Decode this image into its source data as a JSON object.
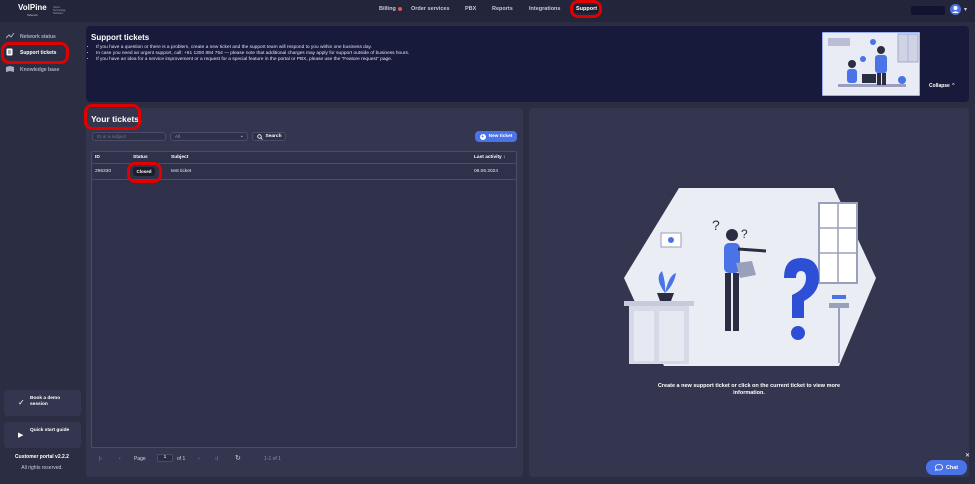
{
  "brand": {
    "name": "VolPine",
    "sub": "Telecom",
    "tagline": "Cloud Technology Solutions"
  },
  "nav": {
    "items": [
      {
        "label": "Billing",
        "has_dot": true
      },
      {
        "label": "Order services"
      },
      {
        "label": "PBX"
      },
      {
        "label": "Reports"
      },
      {
        "label": "Integrations"
      },
      {
        "label": "Support",
        "active": true
      }
    ]
  },
  "sidebar": {
    "items": [
      {
        "label": "Network status",
        "icon": "chart-line-icon"
      },
      {
        "label": "Support tickets",
        "icon": "ticket-icon",
        "active": true
      },
      {
        "label": "Knowledge base",
        "icon": "book-icon"
      }
    ],
    "promos": [
      {
        "label": "Book a demo session",
        "icon": "check-icon"
      },
      {
        "label": "Quick start guide",
        "icon": "play-icon"
      }
    ],
    "version": "Customer portal v2.2.2",
    "rights": "All rights reserved."
  },
  "banner": {
    "title": "Support tickets",
    "bullets": [
      "If you have a question or there is a problem, create a new ticket and the support team will respond to you within one business day.",
      "In case you need an urgent support, call: +61 1300 884 754 — please note that additional charges may apply for support outside of business hours.",
      "If you have an idea for a service improvement or a request for a special feature in the portal or PBX, please use the \"Feature request\" page."
    ],
    "collapse_label": "Collapse"
  },
  "tickets": {
    "title": "Your tickets",
    "search_placeholder": "ID or a subject",
    "filter_value": "All",
    "search_label": "Search",
    "new_label": "New ticket",
    "columns": {
      "id": "ID",
      "status": "Status",
      "subject": "Subject",
      "activity": "Last activity"
    },
    "rows": [
      {
        "id": "296330",
        "status": "Closed",
        "subject": "test ticket",
        "activity": "06.06.2024"
      }
    ],
    "pager": {
      "page_label": "Page",
      "page": "1",
      "of": "of 1",
      "range": "1-1 of 1"
    }
  },
  "detail": {
    "empty_text": "Create a new support ticket or click on the current ticket to view more information."
  },
  "chat": {
    "label": "Chat"
  },
  "colors": {
    "accent": "#4a73e8",
    "highlight": "#e00000",
    "banner": "#181a3c",
    "panel": "#34364f"
  }
}
